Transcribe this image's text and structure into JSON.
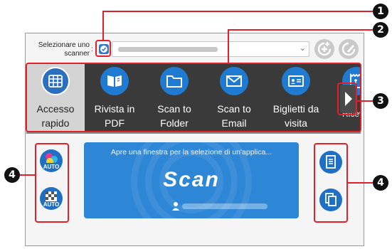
{
  "callouts": [
    "1",
    "2",
    "3",
    "4",
    "4"
  ],
  "scanner_selector": {
    "label": "Selezionare uno scanner",
    "colon": ":",
    "checked": true
  },
  "toolbar": {
    "tiles": [
      {
        "label_line1": "Accesso",
        "label_line2": "rapido",
        "icon": "grid-icon"
      },
      {
        "label_line1": "Rivista in",
        "label_line2": "PDF",
        "icon": "book-icon"
      },
      {
        "label_line1": "Scan to",
        "label_line2": "Folder",
        "icon": "folder-icon"
      },
      {
        "label_line1": "Scan to",
        "label_line2": "Email",
        "icon": "email-icon"
      },
      {
        "label_line1": "Biglietti da",
        "label_line2": "visita",
        "icon": "business-card-icon"
      },
      {
        "label_line1": "Ricevut",
        "label_line2": "",
        "icon": "receipt-icon"
      }
    ]
  },
  "scan_card": {
    "message": "Apre una finestra per la selezione di un'applica...",
    "scan_label": "Scan"
  },
  "left_buttons": [
    {
      "badge": "AUTO",
      "icon": "color-auto-icon"
    },
    {
      "badge": "AUTO",
      "icon": "quality-auto-icon"
    }
  ],
  "right_buttons": [
    {
      "icon": "document-icon"
    },
    {
      "icon": "copy-icon"
    }
  ],
  "colors": {
    "accent_blue": "#1f7bd1",
    "callout_red": "#e0202a",
    "toolbar_bg": "#3a3a3a"
  }
}
